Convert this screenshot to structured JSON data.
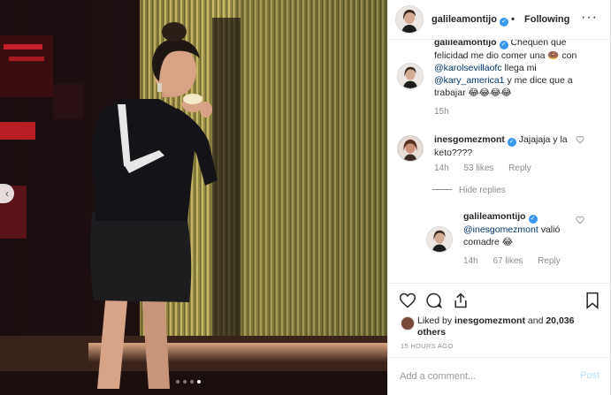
{
  "post": {
    "username": "galileamontijo",
    "follow_status": "Following",
    "more_icon": "more-options-icon",
    "photo_alt": "woman in black dress eating a donut on stage",
    "carousel_dots": 4,
    "active_dot": 3
  },
  "comments": [
    {
      "username": "galileamontijo",
      "text_before": "Chequen que felicidad me dio comer una",
      "emoji": "🍩",
      "text_mid": "con",
      "mention1": "@karolsevillaofc",
      "text_after1": "llega mi",
      "mention2": "@kary_america1",
      "text_after2": "y me dice que a trabajar",
      "emoji_tail": "😂😂😂😂",
      "time": "15h"
    },
    {
      "username": "inesgomezmont",
      "text": "Jajajaja y la keto????",
      "time": "14h",
      "likes": "53 likes",
      "reply": "Reply"
    }
  ],
  "hide_replies": "Hide replies",
  "reply": {
    "username": "galileamontijo",
    "mention": "@inesgomezmont",
    "text": "valió comadre",
    "emoji": "😂",
    "time": "14h",
    "likes": "67 likes",
    "reply": "Reply"
  },
  "likes": {
    "prefix": "Liked by",
    "user": "inesgomezmont",
    "middle": "and",
    "count": "20,036 others"
  },
  "timestamp": "15 HOURS AGO",
  "add_comment": {
    "placeholder": "Add a comment...",
    "post_label": "Post"
  },
  "colors": {
    "verified": "#3897f0",
    "mention": "#003569",
    "post_disabled": "#b2dffc"
  }
}
